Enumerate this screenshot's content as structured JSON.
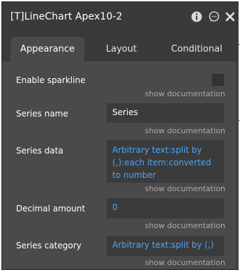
{
  "window": {
    "title": "[T]LineChart Apex10-2"
  },
  "titlebar_icons": {
    "info": "info-icon",
    "comment": "comment-icon",
    "close": "close-icon"
  },
  "tabs": [
    {
      "label": "Appearance",
      "active": true
    },
    {
      "label": "Layout",
      "active": false
    },
    {
      "label": "Conditional",
      "active": false
    }
  ],
  "fields": {
    "sparkline": {
      "label": "Enable sparkline",
      "checked": false,
      "doc": "show documentation"
    },
    "series_name": {
      "label": "Series name",
      "value": "Series",
      "doc": "show documentation"
    },
    "series_data": {
      "label": "Series data",
      "value": "Arbitrary text:split by (,):each item:converted to number",
      "doc": "show documentation"
    },
    "decimal_amount": {
      "label": "Decimal amount",
      "value": "0",
      "doc": "show documentation"
    },
    "series_category": {
      "label": "Series category",
      "value": "Arbitrary text:split by (,)",
      "doc": "show documentation"
    }
  },
  "colors": {
    "panel_bg": "#4a4a4a",
    "header_bg": "#3a3a3a",
    "input_bg": "#3b3b3b",
    "dynamic_text": "#4ea5f0",
    "muted_text": "#a9a9a9",
    "accent": "#1e73d8"
  }
}
